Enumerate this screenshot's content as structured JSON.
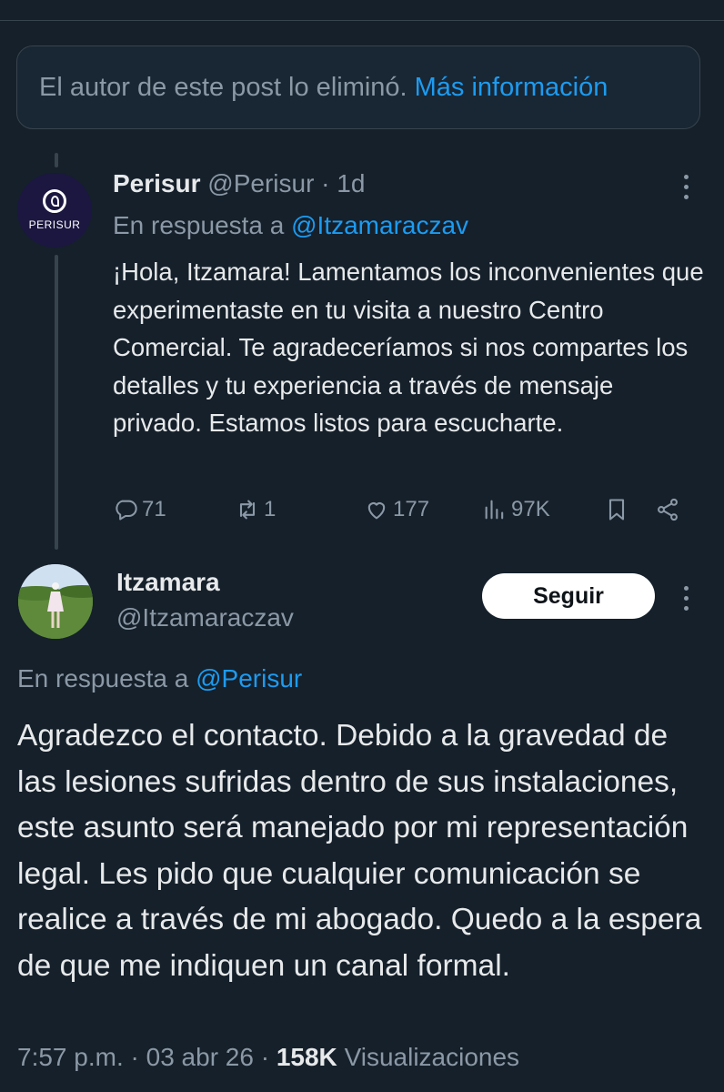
{
  "deleted_notice": {
    "text": "El autor de este post lo eliminó.",
    "link": "Más información"
  },
  "reply": {
    "avatar_text": "PERISUR",
    "name": "Perisur",
    "handle": "@Perisur",
    "separator": " · ",
    "time": "1d",
    "replying_prefix": "En respuesta a ",
    "replying_to": "@Itzamaraczav",
    "body": "¡Hola, Itzamara! Lamentamos los inconvenientes que experimentaste en tu visita a nuestro Centro Comercial. Te agradeceríamos si nos compartes los detalles y tu experiencia a través de mensaje privado.  Estamos listos para escucharte.",
    "stats": {
      "replies": "71",
      "reposts": "1",
      "likes": "177",
      "views": "97K"
    }
  },
  "main_post": {
    "name": "Itzamara",
    "handle": "@Itzamaraczav",
    "follow_label": "Seguir",
    "replying_prefix": "En respuesta a ",
    "replying_to": "@Perisur",
    "body": "Agradezco el contacto. Debido a la gravedad de las lesiones sufridas dentro de sus instalaciones, este asunto será manejado por mi representación legal. Les pido que cualquier comunicación se realice a través de mi abogado. Quedo a la espera de que me indiquen un canal formal.",
    "time": "7:57 p.m.",
    "date": "03 abr 26",
    "separator": " · ",
    "views_count": "158K",
    "views_label": "Visualizaciones"
  },
  "icons": [
    "reply-icon",
    "repost-icon",
    "like-icon",
    "views-icon",
    "bookmark-icon",
    "share-icon",
    "more-icon"
  ],
  "colors": {
    "background": "#15202b",
    "text": "#e7e9ea",
    "muted": "#8b98a5",
    "link": "#1d9bf0",
    "border": "#38444d"
  }
}
